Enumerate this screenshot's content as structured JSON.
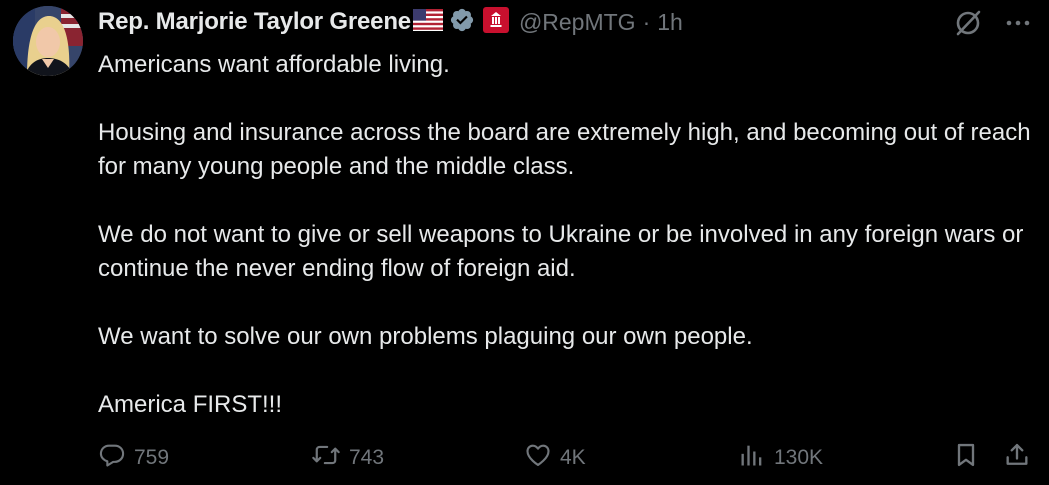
{
  "author": {
    "name": "Rep. Marjorie Taylor Greene",
    "handle": "@RepMTG",
    "separator": "·",
    "time": "1h",
    "flag_icon": "us-flag-icon",
    "verified_icon": "verified-badge-icon",
    "affiliation_icon": "government-affiliation-icon"
  },
  "tweet": {
    "paragraphs": [
      "Americans want affordable living.",
      "Housing and insurance across the board are extremely high, and becoming out of reach for many young people and the middle class.",
      "We do not want to give or sell weapons to Ukraine or be involved in any foreign wars or continue the never ending flow of foreign aid.",
      "We want to solve our own problems plaguing our own people.",
      "America FIRST!!!"
    ]
  },
  "stats": {
    "replies": "759",
    "retweets": "743",
    "likes": "4K",
    "views": "130K"
  },
  "colors": {
    "background": "#000000",
    "text": "#e7e9ea",
    "muted": "#71767b",
    "verified_badge": "#829aab",
    "affiliation": "#c8102e"
  },
  "icons": {
    "top": [
      "grok-icon",
      "more-icon"
    ],
    "actions": [
      "reply-icon",
      "retweet-icon",
      "like-icon",
      "views-icon",
      "bookmark-icon",
      "share-icon"
    ]
  }
}
